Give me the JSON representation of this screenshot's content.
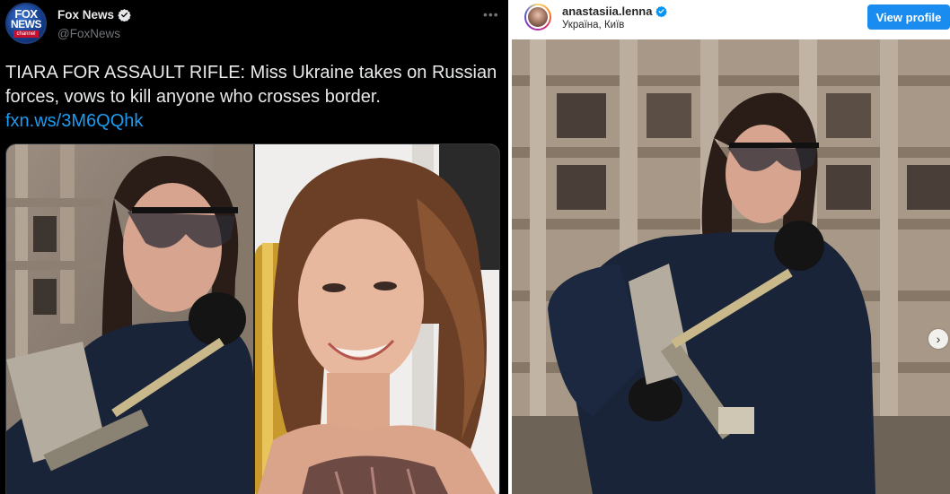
{
  "tweet": {
    "account_name": "Fox News",
    "handle": "@FoxNews",
    "avatar_logo": {
      "line1": "FOX",
      "line2": "NEWS",
      "line3": "channel"
    },
    "text": "TIARA FOR ASSAULT RIFLE: Miss Ukraine takes on Russian forces, vows to kill anyone who crosses border.",
    "link": "fxn.ws/3M6QQhk",
    "icons": [
      "verified-badge-icon",
      "more-options-icon"
    ],
    "colors": {
      "background": "#000000",
      "text": "#e7e9ea",
      "secondary": "#71767b",
      "link": "#1d9bf0"
    }
  },
  "instagram": {
    "username": "anastasiia.lenna",
    "location": "Україна, Київ",
    "view_profile_label": "View profile",
    "next_label": "›",
    "icons": [
      "verified-badge-icon",
      "next-arrow-icon"
    ],
    "colors": {
      "button": "#1a8cf0",
      "text": "#262626"
    }
  }
}
